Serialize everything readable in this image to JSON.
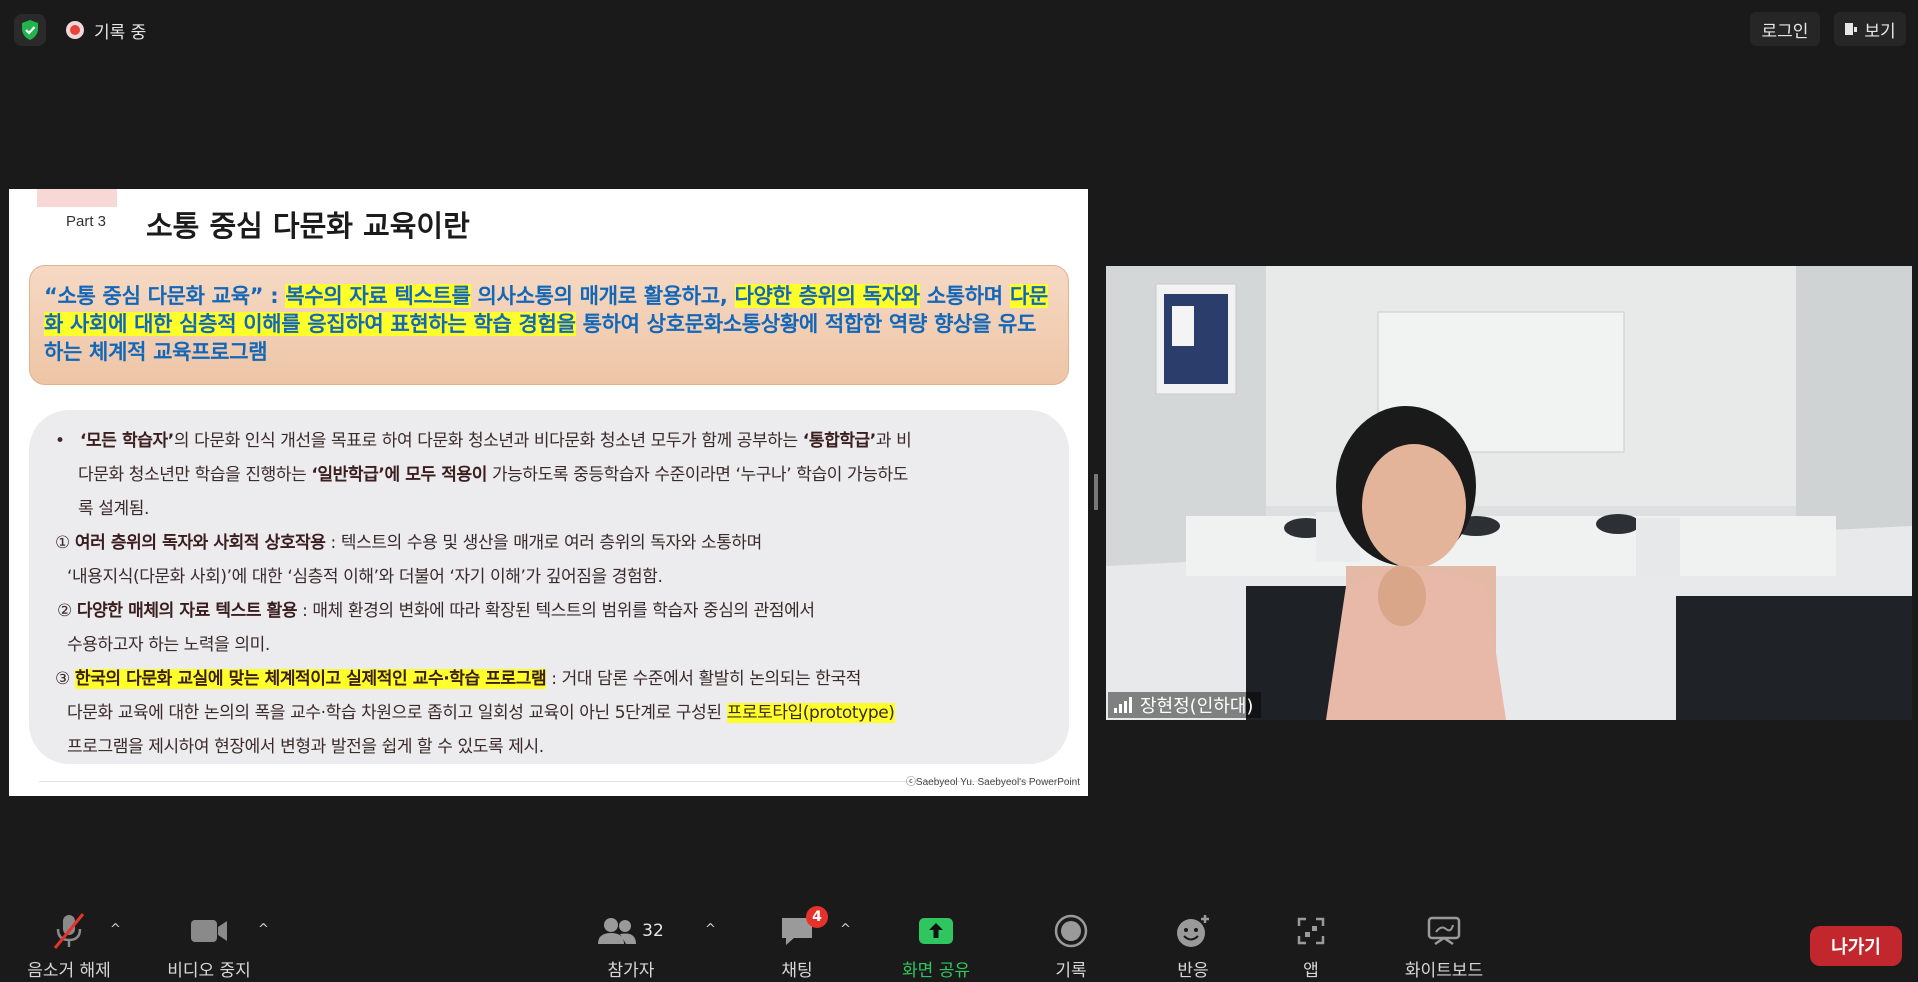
{
  "top_bar": {
    "recording_label": "기록 중",
    "login_label": "로그인",
    "view_label": "보기"
  },
  "slide": {
    "part": "Part 3",
    "title": "소통 중심 다문화 교육이란",
    "definition": {
      "s1": "“소통 중심 다문화 교육” : ",
      "s2": "복수의 자료 텍스트를",
      "s3": " 의사소통의 매개로 활용하고, ",
      "s4": "다양한 층위의 독자와",
      "s5": " 소통하며 ",
      "s6": "다문화 사회에 대한 심층적 이해를 응집하여 표현하는 학습 경험을",
      "s7": " 통하여 상호문화소통상황에 적합한 역량 향상을 유도하는 체계적 교육프로그램"
    },
    "bullet": {
      "marker": "•",
      "b1": "‘모든 학습자’",
      "t1": "의 다문화 인식 개선을 목표로 하여  다문화 청소년과 비다문화 청소년 모두가 함께 공부하는 ",
      "b2": "‘통합학급’",
      "t2": "과 비",
      "t3": "다문화 청소년만 학습을 진행하는 ",
      "b3": "‘일반학급’에 모두 적용이",
      "t4": " 가능하도록 중등학습자 수준이라면 ‘누구나’ 학습이  가능하도",
      "t5": "록 설계됨."
    },
    "item1": {
      "num": "①",
      "bold": "여러 층위의 독자와 사회적 상호작용",
      "text": " : 텍스트의 수용 및 생산을 매개로 여러 층위의 독자와 소통하며",
      "text2": "‘내용지식(다문화 사회)’에 대한 ‘심층적 이해’와 더불어 ‘자기 이해’가 깊어짐을 경험함."
    },
    "item2": {
      "num": "②",
      "bold": "다양한 매체의 자료 텍스트 활용",
      "text": " : 매체 환경의 변화에 따라 확장된 텍스트의 범위를  학습자 중심의 관점에서",
      "text2": "수용하고자 하는 노력을 의미."
    },
    "item3": {
      "num": "③",
      "bold": "한국의 다문화 교실에 맞는 체계적이고 실제적인 교수·학습 프로그램",
      "text": " : 거대 담론 수준에서 활발히 논의되는 한국적",
      "text2": "다문화 교육에 대한 논의의 폭을 교수·학습 차원으로 좁히고 일회성 교육이 아닌 5단계로 구성된 ",
      "highlight": "프로토타입(prototype)",
      "text3": "프로그램을 제시하여 현장에서 변형과 발전을 쉽게 할 수 있도록 제시."
    },
    "copyright": "ⓒSaebyeol Yu. Saebyeol's PowerPoint"
  },
  "video": {
    "participant_name": "장현정(인하대)"
  },
  "toolbar": {
    "mute_label": "음소거 해제",
    "video_label": "비디오 중지",
    "participants_label": "참가자",
    "participants_count": "32",
    "chat_label": "채팅",
    "chat_badge": "4",
    "share_label": "화면 공유",
    "record_label": "기록",
    "reactions_label": "반응",
    "apps_label": "앱",
    "whiteboard_label": "화이트보드",
    "leave_label": "나가기"
  },
  "colors": {
    "background": "#1a1a1a",
    "share_green": "#2fc65f",
    "leave_red": "#c1272d",
    "highlight_yellow": "#ffff2a",
    "definition_blue": "#1367b8"
  }
}
